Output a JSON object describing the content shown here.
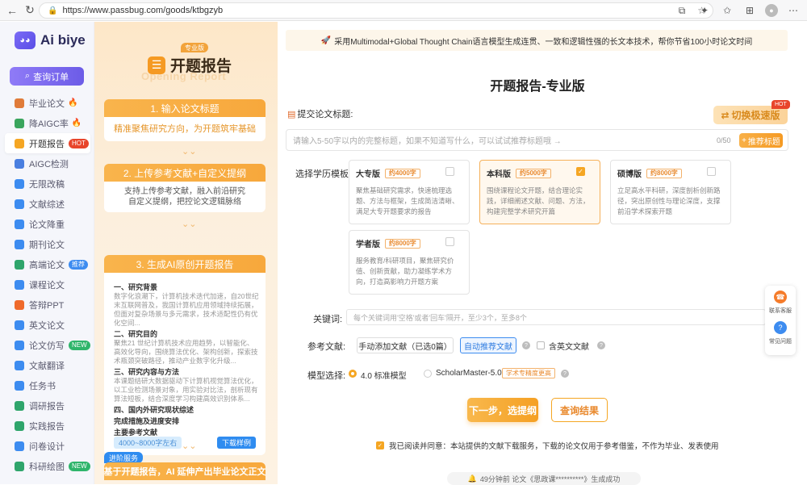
{
  "browser": {
    "url": "https://www.passbug.com/goods/ktbgzyb"
  },
  "sidebar": {
    "logo_text": "Ai biye",
    "logo_icon": "robot-icon",
    "query_button": "查询订单",
    "items": [
      {
        "label": "毕业论文",
        "icon": "graduation-icon",
        "color": "#e07b39",
        "fire": true
      },
      {
        "label": "降AIGC率",
        "icon": "aigc-icon",
        "color": "#3aa55d",
        "fire": true
      },
      {
        "label": "开题报告",
        "icon": "report-icon",
        "color": "#f5a623",
        "badge": "HOT",
        "badge_color": "#e8452b",
        "active": true
      },
      {
        "label": "AIGC检测",
        "icon": "detect-icon",
        "color": "#4a7fe0"
      },
      {
        "label": "无限改稿",
        "icon": "edit-icon",
        "color": "#3d8cf0"
      },
      {
        "label": "文献综述",
        "icon": "literature-icon",
        "color": "#3d8cf0"
      },
      {
        "label": "论文降重",
        "icon": "reduce-icon",
        "color": "#3d8cf0"
      },
      {
        "label": "期刊论文",
        "icon": "journal-icon",
        "color": "#3d8cf0"
      },
      {
        "label": "高端论文",
        "icon": "premium-icon",
        "color": "#2fa56b",
        "badge": "推荐",
        "badge_color": "#3d8cf0"
      },
      {
        "label": "课程论文",
        "icon": "course-icon",
        "color": "#3d8cf0"
      },
      {
        "label": "答辩PPT",
        "icon": "ppt-icon",
        "color": "#ef6a2b"
      },
      {
        "label": "英文论文",
        "icon": "english-icon",
        "color": "#3d8cf0"
      },
      {
        "label": "论文仿写",
        "icon": "imitate-icon",
        "color": "#3d8cf0",
        "badge": "NEW",
        "badge_color": "#2fb56b"
      },
      {
        "label": "文献翻译",
        "icon": "translate-icon",
        "color": "#3d8cf0"
      },
      {
        "label": "任务书",
        "icon": "task-icon",
        "color": "#3d8cf0"
      },
      {
        "label": "调研报告",
        "icon": "survey-icon",
        "color": "#2fa56b"
      },
      {
        "label": "实践报告",
        "icon": "practice-icon",
        "color": "#2fa56b"
      },
      {
        "label": "问卷设计",
        "icon": "questionnaire-icon",
        "color": "#3d8cf0"
      },
      {
        "label": "科研绘图",
        "icon": "drawing-icon",
        "color": "#2fa56b",
        "badge": "NEW",
        "badge_color": "#2fb56b"
      }
    ]
  },
  "promo": {
    "pro_tag": "专业版",
    "title": "开题报告",
    "subtitle": "Opening Report",
    "step1": {
      "head": "1. 输入论文标题",
      "body": "精准聚焦研究方向，为开题筑牢基础"
    },
    "step2": {
      "head": "2. 上传参考文献+自定义提纲",
      "body1": "支持上传参考文献，融入前沿研究",
      "body2": "自定义提纲，把控论文逻辑脉络"
    },
    "step3": {
      "head": "3. 生成AI原创开题报告",
      "sections": [
        {
          "h": "一、研究背景",
          "p": "数字化浪潮下，计算机技术迭代加速，自20世纪末互联网普及，我国计算机应用领域持续拓展，但面对复杂场景与多元需求，技术适配性仍有优化空间..."
        },
        {
          "h": "二、研究目的",
          "p": "聚焦21 世纪计算机技术应用趋势，以智能化、高效化导向，围绕算法优化、架构创新，探索技术瓶颈突破路径，推动产业数字化升级..."
        },
        {
          "h": "三、研究内容与方法",
          "p": "本课题结研大数据驱动下计算机视觉算法优化，以工业检测场景对象，用实验对比法，剖析现有算法短板，结合深度学习构建高效识别体系..."
        },
        {
          "h": "四、国内外研究现状综述",
          "p": ""
        },
        {
          "h": "完成措施及进度安排",
          "p": ""
        },
        {
          "h": "主要参考文献",
          "p": ""
        }
      ],
      "word_count": "4000~8000字左右",
      "download": "下载样例"
    },
    "advanced_tag": "进阶服务",
    "advanced_bar": "基于开题报告，AI 延伸产出毕业论文正文"
  },
  "main": {
    "banner": "采用Multimodal+Global Thought Chain语言模型生成连贯、一致和逻辑性强的长文本技术，帮你节省100小时论文时间",
    "page_title": "开题报告-专业版",
    "title_label": "提交论文标题:",
    "switch_button": "切换极速版",
    "hot_tag": "HOT",
    "title_placeholder": "请输入5-50字以内的完整标题，如果不知道写什么，可以试试推荐标题哦 →",
    "counter": "0/50",
    "recommend_button": "推荐标题",
    "edu_label": "选择学历模板",
    "cards": [
      {
        "name": "大专版",
        "words": "约4000字",
        "desc": "聚焦基础研究需求，快速梳理选题、方法与框架，生成简洁清晰、满足大专开题要求的报告",
        "selected": false
      },
      {
        "name": "本科版",
        "words": "约5000字",
        "desc": "围绕课程论文开题，结合理论实践，详细阐述文献、问题、方法，构建完整学术研究开篇",
        "selected": true
      },
      {
        "name": "硕博版",
        "words": "约8000字",
        "desc": "立足高水平科研，深度剖析创新路径，突出原创性与理论深度，支撑前沿学术探索开题",
        "selected": false
      },
      {
        "name": "学者版",
        "words": "约8000字",
        "desc": "服务教育/科研项目，聚焦研究价值、创新贡献，助力凝练学术方向，打造高影响力开题方案",
        "selected": false
      }
    ],
    "keyword_label": "关键词:",
    "keyword_placeholder": "每个关键词用'空格'或者'回车'隔开，至少3个，至多8个",
    "ref_label": "参考文献:",
    "manual_ref": "手动添加文献（已选0篇）",
    "auto_ref": "自动推荐文献",
    "english_ref": "含英文文献",
    "model_label": "模型选择:",
    "model1": "4.0 标准模型",
    "model2": "ScholarMaster-5.0",
    "model2_tag": "学术专精度更高",
    "next_button": "下一步，选提纲",
    "result_button": "查询结果",
    "agree_text": "我已阅读并同意：本站提供的文献下载服务，下载的论文仅用于参考借鉴，不作为毕业、发表使用",
    "ticker": "49分钟前 论文《思政课**********》生成成功"
  },
  "float": {
    "service": "联系客服",
    "faq": "常见问题"
  }
}
